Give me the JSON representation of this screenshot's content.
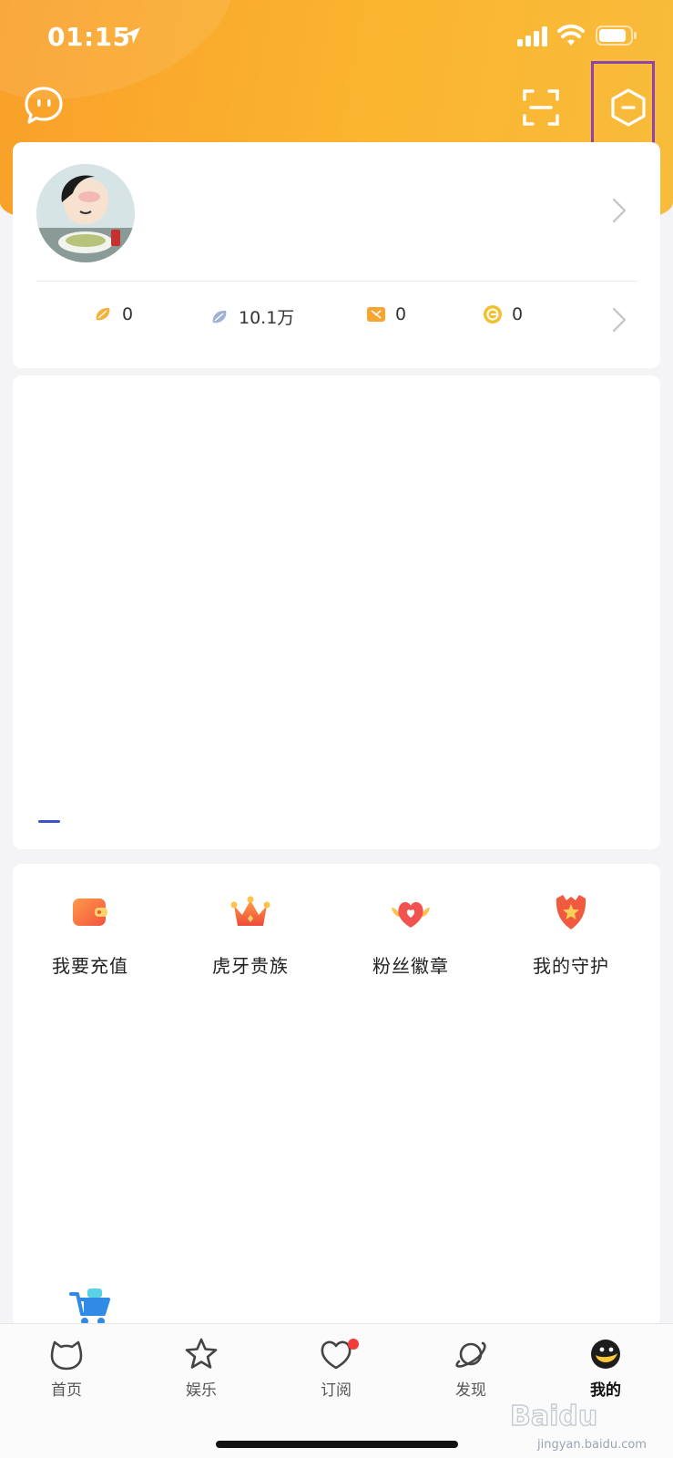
{
  "status_bar": {
    "time": "01:15"
  },
  "profile": {
    "stats": [
      {
        "icon": "yellow-bean-icon",
        "value": "0",
        "color": "#f5b23a"
      },
      {
        "icon": "silver-bean-icon",
        "value": "10.1万",
        "color": "#9fb2d6"
      },
      {
        "icon": "ticket-icon",
        "value": "0",
        "color": "#f7a530"
      },
      {
        "icon": "coin-icon",
        "value": "0",
        "color": "#f3c02d"
      }
    ]
  },
  "menu": {
    "items": [
      {
        "icon": "wallet-icon",
        "label": "我要充值"
      },
      {
        "icon": "crown-icon",
        "label": "虎牙贵族"
      },
      {
        "icon": "heart-badge-icon",
        "label": "粉丝徽章"
      },
      {
        "icon": "shield-icon",
        "label": "我的守护"
      }
    ]
  },
  "tabs": [
    {
      "icon": "cat-head-icon",
      "label": "首页"
    },
    {
      "icon": "star-icon",
      "label": "娱乐"
    },
    {
      "icon": "heart-icon",
      "label": "订阅"
    },
    {
      "icon": "planet-icon",
      "label": "发现"
    },
    {
      "icon": "me-face-icon",
      "label": "我的"
    }
  ],
  "watermark": {
    "brand": "Baidu",
    "site": "jingyan.baidu.com"
  },
  "colors": {
    "accent": "#fbb52f",
    "highlight": "#8e44ad",
    "badge": "#f23b3b"
  }
}
